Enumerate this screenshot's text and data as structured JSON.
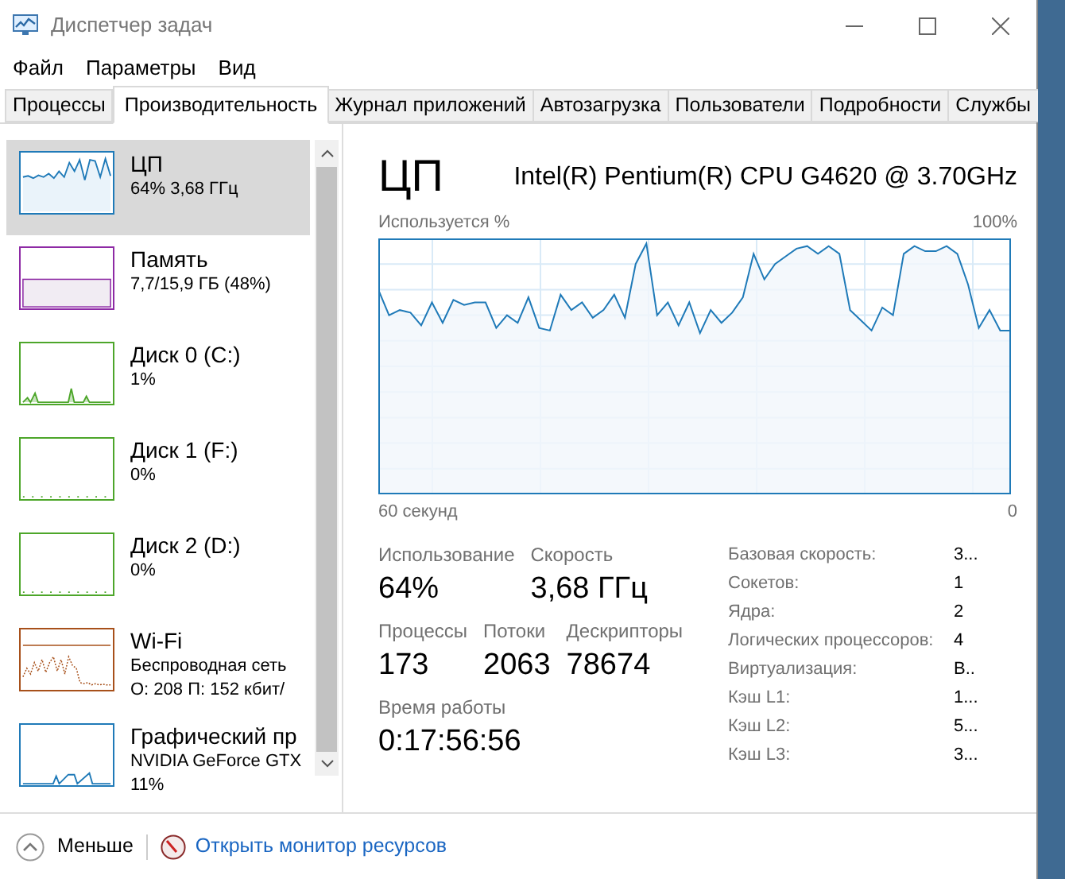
{
  "window": {
    "title": "Диспетчер задач"
  },
  "menu": [
    "Файл",
    "Параметры",
    "Вид"
  ],
  "tabs": [
    {
      "label": "Процессы",
      "selected": false
    },
    {
      "label": "Производительность",
      "selected": true
    },
    {
      "label": "Журнал приложений",
      "selected": false
    },
    {
      "label": "Автозагрузка",
      "selected": false
    },
    {
      "label": "Пользователи",
      "selected": false
    },
    {
      "label": "Подробности",
      "selected": false
    },
    {
      "label": "Службы",
      "selected": false
    }
  ],
  "sidebar": {
    "items": [
      {
        "kind": "cpu",
        "name": "ЦП",
        "details": [
          "64% 3,68 ГГц"
        ],
        "color": "#1f7ab8",
        "selected": true
      },
      {
        "kind": "memory",
        "name": "Память",
        "details": [
          "7,7/15,9 ГБ (48%)"
        ],
        "color": "#8e2aa5",
        "selected": false
      },
      {
        "kind": "disk",
        "name": "Диск 0 (C:)",
        "details": [
          "1%"
        ],
        "color": "#4da62a",
        "selected": false
      },
      {
        "kind": "idle",
        "name": "Диск 1 (F:)",
        "details": [
          "0%"
        ],
        "color": "#4da62a",
        "selected": false
      },
      {
        "kind": "idle",
        "name": "Диск 2 (D:)",
        "details": [
          "0%"
        ],
        "color": "#4da62a",
        "selected": false
      },
      {
        "kind": "network",
        "name": "Wi-Fi",
        "details": [
          "Беспроводная сеть",
          "О: 208 П: 152 кбит/"
        ],
        "color": "#a7501a",
        "selected": false
      },
      {
        "kind": "gpu",
        "name": "Графический пр",
        "details": [
          "NVIDIA GeForce GTX",
          "11%"
        ],
        "color": "#1f7ab8",
        "selected": false
      }
    ]
  },
  "panel": {
    "title": "ЦП",
    "model": "Intel(R) Pentium(R) CPU G4620 @ 3.70GHz",
    "chart": {
      "ylabel": "Используется %",
      "ymax": "100%",
      "xlabel": "60 секунд",
      "xmin": "0"
    },
    "stats": [
      [
        {
          "label": "Использование",
          "value": "64%"
        },
        {
          "label": "Скорость",
          "value": "3,68 ГГц"
        }
      ],
      [
        {
          "label": "Процессы",
          "value": "173"
        },
        {
          "label": "Потоки",
          "value": "2063"
        },
        {
          "label": "Дескрипторы",
          "value": "78674"
        }
      ],
      [
        {
          "label": "Время работы",
          "value": "0:17:56:56"
        }
      ]
    ],
    "specs": [
      {
        "label": "Базовая скорость:",
        "value": "3..."
      },
      {
        "label": "Сокетов:",
        "value": "1"
      },
      {
        "label": "Ядра:",
        "value": "2"
      },
      {
        "label": "Логических процессоров:",
        "value": "4"
      },
      {
        "label": "Виртуализация:",
        "value": "В.."
      },
      {
        "label": "Кэш L1:",
        "value": "1..."
      },
      {
        "label": "Кэш L2:",
        "value": "5..."
      },
      {
        "label": "Кэш L3:",
        "value": "3..."
      }
    ]
  },
  "footer": {
    "less": "Меньше",
    "link": "Открыть монитор ресурсов"
  }
}
